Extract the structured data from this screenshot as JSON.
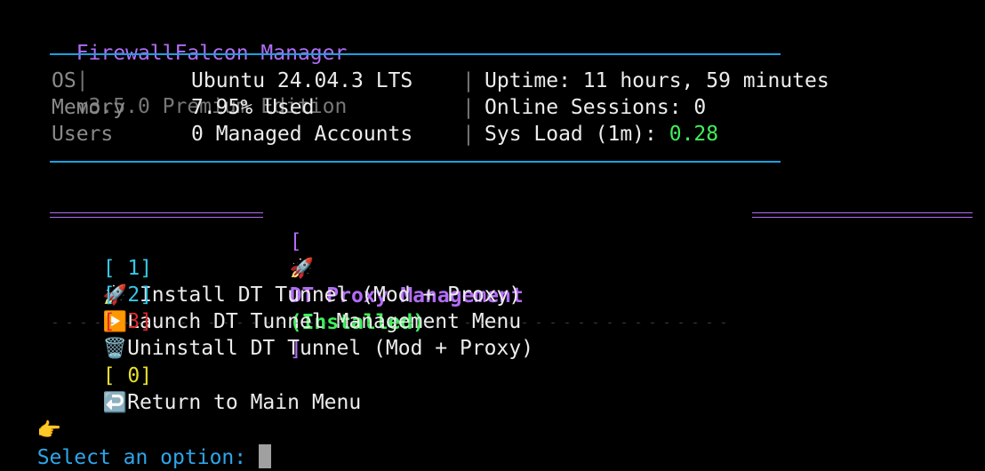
{
  "header": {
    "app_name": "FirewallFalcon Manager",
    "separator": "|",
    "version": "v3.5.0 Premium Edition"
  },
  "info": {
    "rows": [
      {
        "label": "OS",
        "value": "Ubuntu 24.04.3 LTS",
        "right_label": "Uptime: ",
        "right_value": "11 hours, 59 minutes"
      },
      {
        "label": "Memory",
        "value": "7.95% Used",
        "right_label": "Online Sessions: ",
        "right_value": "0"
      },
      {
        "label": "Users",
        "value": "0 Managed Accounts",
        "right_label": "Sys Load (1m): ",
        "right_value": "0.28"
      }
    ],
    "column_separator": "|"
  },
  "section": {
    "bracket_open": "[",
    "icon": "🚀",
    "title": "DT Proxy Management",
    "status": "(Installed)",
    "bracket_close": "]"
  },
  "menu": {
    "items": [
      {
        "key": "[ 1]",
        "icon": "🚀",
        "label": " Install DT Tunnel (Mod + Proxy)"
      },
      {
        "key": "[ 2]",
        "icon": "▶️",
        "label": "Launch DT Tunnel Management Menu"
      },
      {
        "key": "[ 3]",
        "icon": "🗑️",
        "label": "Uninstall DT Tunnel (Mod + Proxy)"
      }
    ],
    "return_item": {
      "key": "[ 0]",
      "icon": "↩️",
      "label": "Return to Main Menu"
    }
  },
  "prompt": {
    "icon": "👉",
    "text": "Select an option: "
  },
  "colors": {
    "accent_purple": "#b26cf5",
    "rule_blue": "#1aa0e0",
    "ok_green": "#3ef05a",
    "key_cyan": "#36c7e6",
    "danger_red": "#e02828",
    "return_yellow": "#e8e02a",
    "prompt_blue": "#2ea6ea"
  }
}
